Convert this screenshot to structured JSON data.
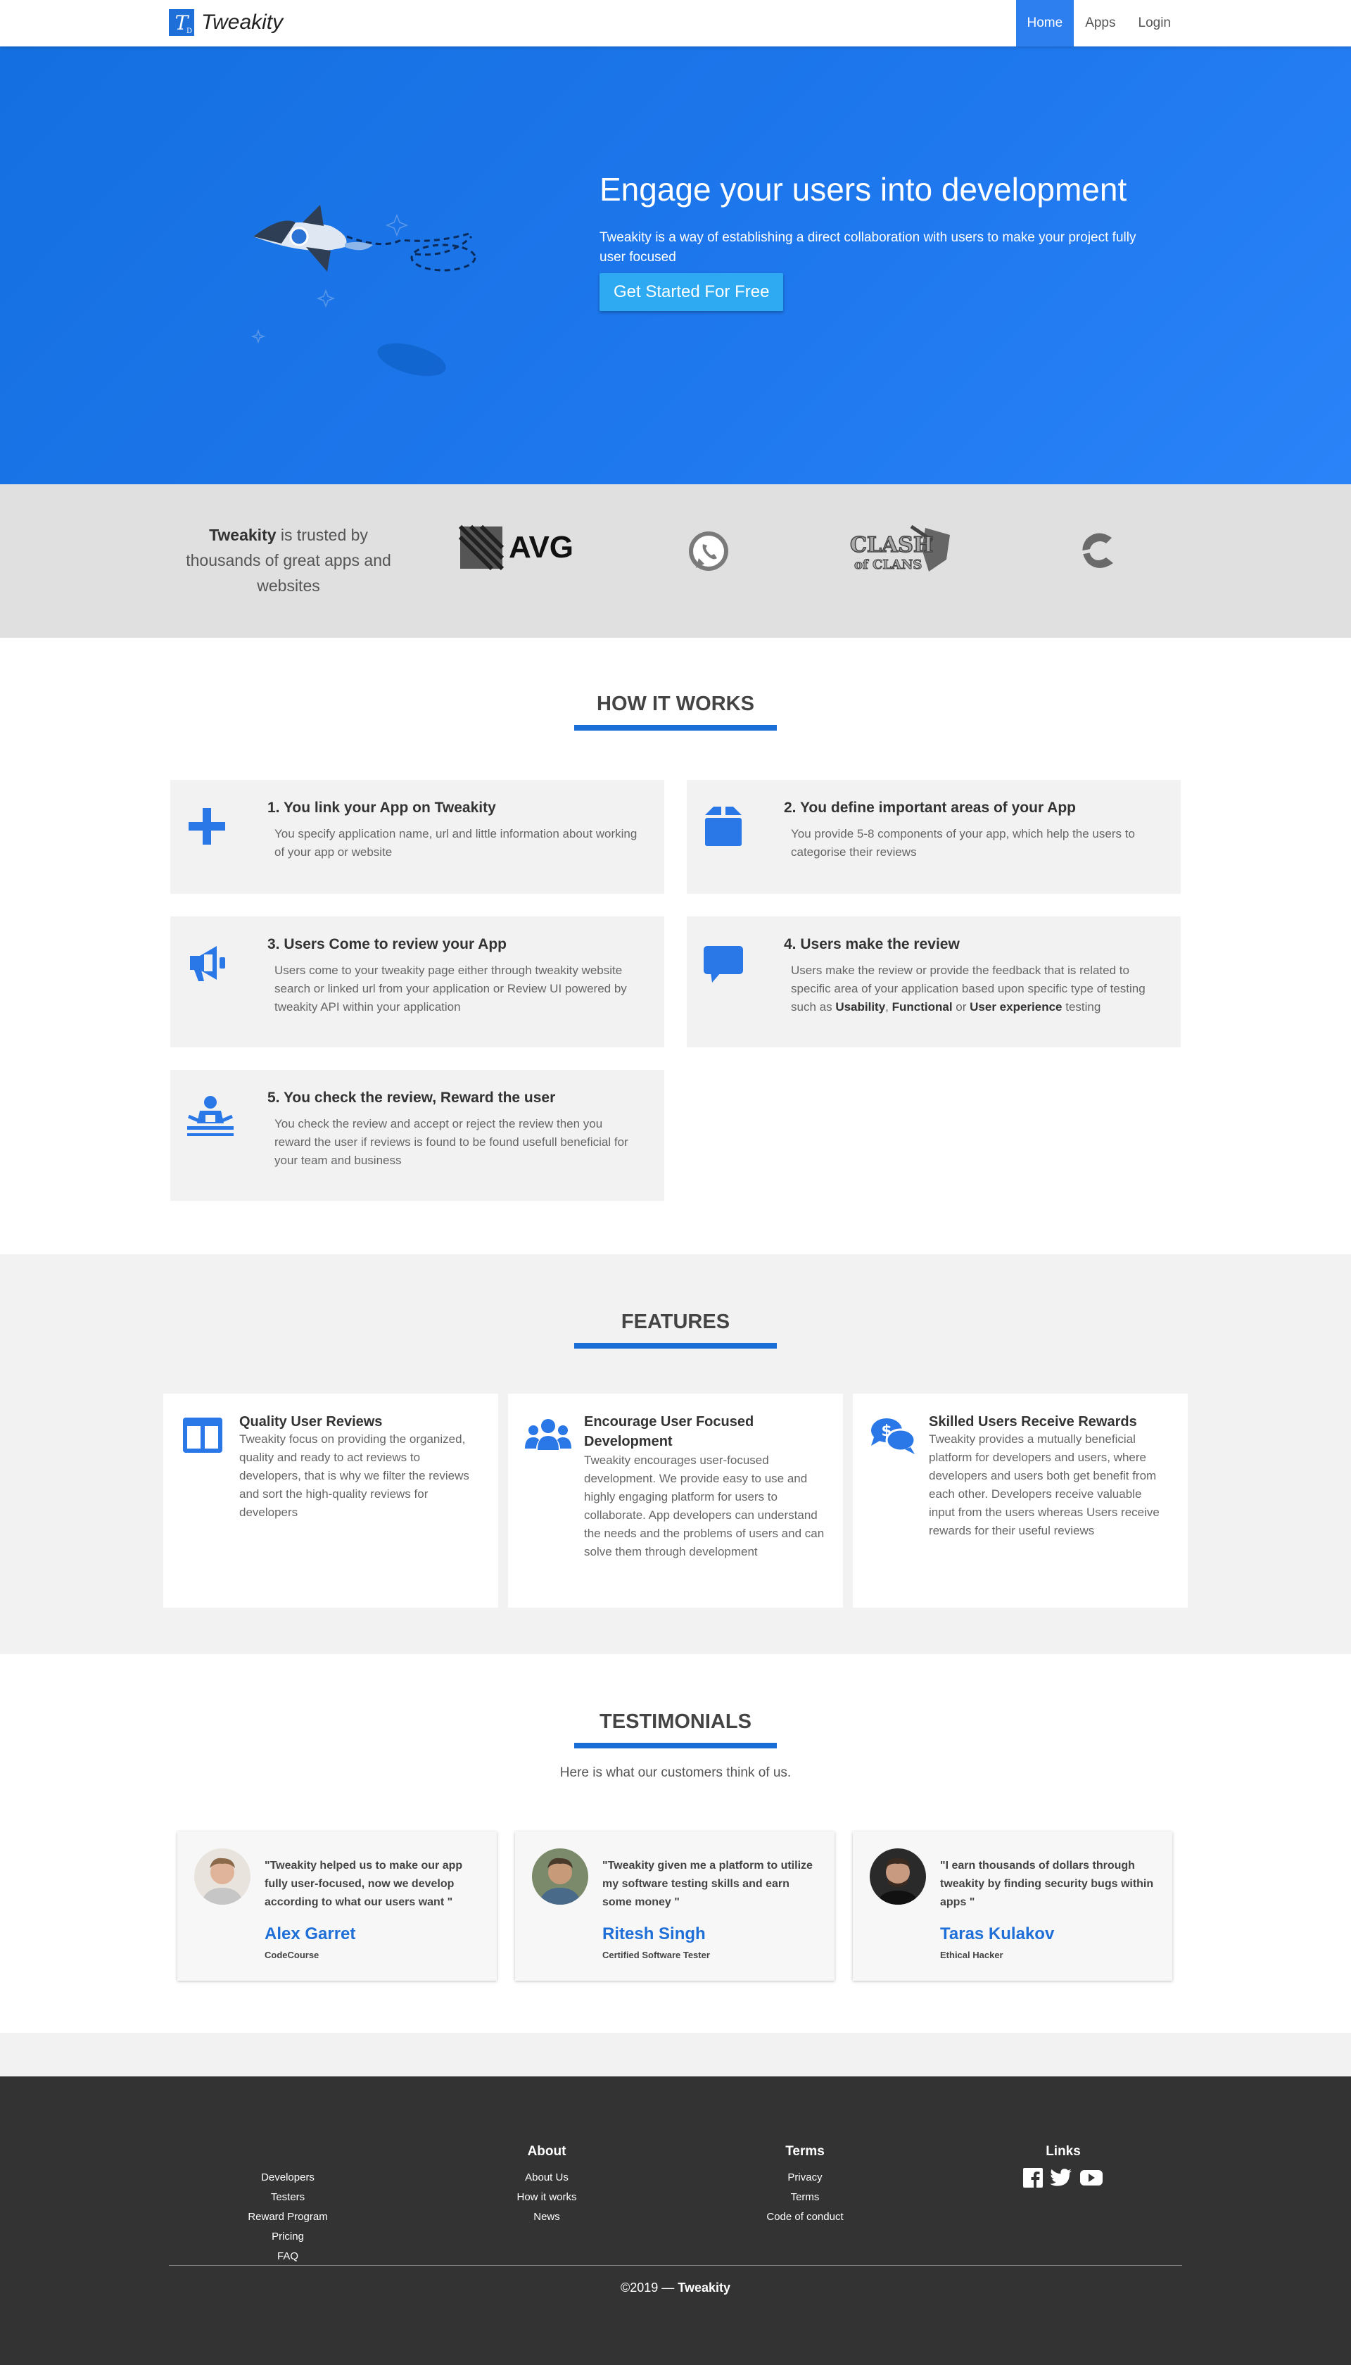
{
  "navbar": {
    "brand_letter": "T",
    "brand_sub": "D",
    "brand_name": "Tweakity",
    "links": [
      {
        "label": "Home",
        "active": true
      },
      {
        "label": "Apps",
        "active": false
      },
      {
        "label": "Login",
        "active": false
      }
    ]
  },
  "hero": {
    "title": "Engage your users into development",
    "subtitle": "Tweakity is a way of establishing a direct collaboration with users to make your project fully user focused",
    "cta_label": "Get Started For Free"
  },
  "trust": {
    "brand": "Tweakity",
    "text": " is trusted by thousands of great apps and websites",
    "logos": [
      "avg-logo",
      "whatsapp-logo",
      "clash-of-clans-logo",
      "ccleaner-logo"
    ],
    "avg_text": "AVG",
    "clash_text_top": "CLASH",
    "clash_text_bottom": "of CLANS"
  },
  "how": {
    "title": "HOW IT WORKS",
    "steps": [
      {
        "title": "1. You link your App on Tweakity",
        "text": "You specify application name, url and little information about working of your app or website",
        "icon": "plus-icon"
      },
      {
        "title": "2. You define important areas of your App",
        "text": "You provide 5-8 components of your app, which help the users to categorise their reviews",
        "icon": "box-icon"
      },
      {
        "title": "3. Users Come to review your App",
        "text": "Users come to your tweakity page either through tweakity website search or linked url from your application or Review UI powered by tweakity API within your application",
        "icon": "megaphone-icon"
      },
      {
        "title": "4. Users make the review",
        "text_pre": "Users make the review or provide the feedback that is related to specific area of your application based upon specific type of testing such as ",
        "b1": "Usability",
        "sep1": ", ",
        "b2": "Functional",
        "sep2": " or ",
        "b3": "User experience",
        "text_post": " testing",
        "icon": "comment-icon"
      },
      {
        "title": "5. You check the review, Reward the user",
        "text": "You check the review and accept or reject the review then you reward the user if reviews is found to be found usefull beneficial for your team and business",
        "icon": "user-desk-icon"
      }
    ]
  },
  "features": {
    "title": "FEATURES",
    "items": [
      {
        "title": "Quality User Reviews",
        "text": "Tweakity focus on providing the organized, quality and ready to act reviews to developers, that is why we filter the reviews and sort the high-quality reviews for developers",
        "icon": "columns-icon"
      },
      {
        "title": "Encourage User Focused Development",
        "text": "Tweakity encourages user-focused development. We provide easy to use and highly engaging platform for users to collaborate. App developers can understand the needs and the problems of users and can solve them through development",
        "icon": "users-icon"
      },
      {
        "title": "Skilled Users Receive Rewards",
        "text": "Tweakity provides a mutually beneficial platform for developers and users, where developers and users both get benefit from each other. Developers receive valuable input from the users whereas Users receive rewards for their useful reviews",
        "icon": "money-chat-icon"
      }
    ]
  },
  "testimonials": {
    "title": "TESTIMONIALS",
    "subtitle": "Here is what our customers think of us.",
    "items": [
      {
        "quote": "\"Tweakity helped us to make our app fully user-focused, now we develop according to what our users want \"",
        "name": "Alex Garret",
        "role": "CodeCourse"
      },
      {
        "quote": "\"Tweakity given me a platform to utilize my software testing skills and earn some money \"",
        "name": "Ritesh Singh",
        "role": "Certified Software Tester"
      },
      {
        "quote": "\"I earn thousands of dollars through tweakity by finding security bugs within apps \"",
        "name": "Taras Kulakov",
        "role": "Ethical Hacker"
      }
    ]
  },
  "footer": {
    "col1": {
      "title": "",
      "links": [
        "Developers",
        "Testers",
        "Reward Program",
        "Pricing",
        "FAQ"
      ]
    },
    "col2": {
      "title": "About",
      "links": [
        "About Us",
        "How it works",
        "News"
      ]
    },
    "col3": {
      "title": "Terms",
      "links": [
        "Privacy",
        "Terms",
        "Code of conduct"
      ]
    },
    "col4": {
      "title": "Links",
      "icons": [
        "facebook-icon",
        "twitter-icon",
        "youtube-icon"
      ]
    },
    "copyright_pre": "©2019 — ",
    "copyright_brand": "Tweakity"
  },
  "colors": {
    "primary": "#1f6fd8",
    "hero_start": "#1470e0",
    "hero_end": "#2a84f8",
    "cta": "#2eaaf2",
    "footer_bg": "#333333",
    "section_gray": "#f2f2f2"
  }
}
